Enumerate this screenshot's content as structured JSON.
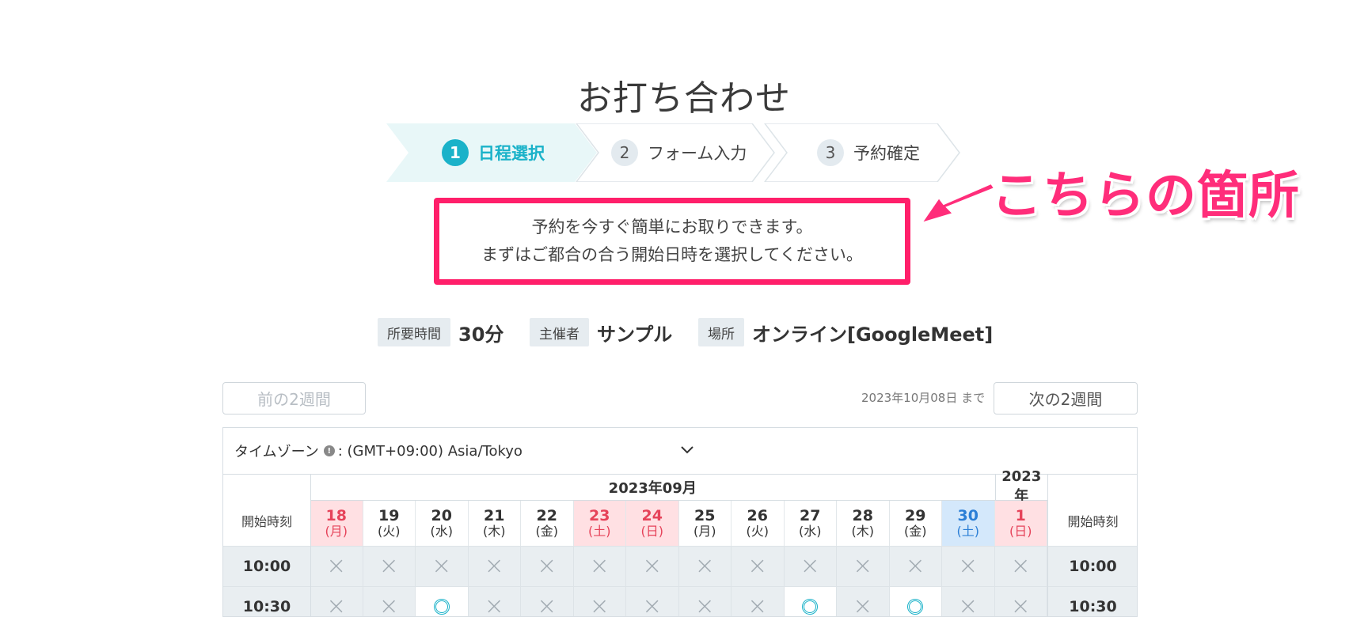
{
  "page": {
    "title": "お打ち合わせ"
  },
  "steps": [
    {
      "num": "1",
      "label": "日程選択",
      "state": "active"
    },
    {
      "num": "2",
      "label": "フォーム入力",
      "state": "inactive"
    },
    {
      "num": "3",
      "label": "予約確定",
      "state": "inactive"
    }
  ],
  "intro": {
    "line1": "予約を今すぐ簡単にお取りできます。",
    "line2": "まずはご都合の合う開始日時を選択してください。"
  },
  "annotation": {
    "text": "こちらの箇所",
    "color": "#ff2d7a"
  },
  "meta": {
    "duration_label": "所要時間",
    "duration_value": "30分",
    "host_label": "主催者",
    "host_value": "サンプル",
    "location_label": "場所",
    "location_value": "オンライン[GoogleMeet]"
  },
  "nav": {
    "prev_label": "前の2週間",
    "next_label": "次の2週間",
    "until_text": "2023年10月08日 まで"
  },
  "calendar": {
    "timezone_label": "タイムゾーン",
    "timezone_value": ": (GMT+09:00) Asia/Tokyo",
    "month1": "2023年09月",
    "month2": "2023年",
    "start_time_label": "開始時刻",
    "days": [
      {
        "date": "18",
        "dow": "(月)",
        "type": "hol"
      },
      {
        "date": "19",
        "dow": "(火)",
        "type": "wk"
      },
      {
        "date": "20",
        "dow": "(水)",
        "type": "wk"
      },
      {
        "date": "21",
        "dow": "(木)",
        "type": "wk"
      },
      {
        "date": "22",
        "dow": "(金)",
        "type": "wk"
      },
      {
        "date": "23",
        "dow": "(土)",
        "type": "hol"
      },
      {
        "date": "24",
        "dow": "(日)",
        "type": "hol"
      },
      {
        "date": "25",
        "dow": "(月)",
        "type": "wk"
      },
      {
        "date": "26",
        "dow": "(火)",
        "type": "wk"
      },
      {
        "date": "27",
        "dow": "(水)",
        "type": "wk"
      },
      {
        "date": "28",
        "dow": "(木)",
        "type": "wk"
      },
      {
        "date": "29",
        "dow": "(金)",
        "type": "wk"
      },
      {
        "date": "30",
        "dow": "(土)",
        "type": "sat"
      },
      {
        "date": "1",
        "dow": "(日)",
        "type": "hol"
      }
    ],
    "rows": [
      {
        "time": "10:00",
        "slots": [
          0,
          0,
          0,
          0,
          0,
          0,
          0,
          0,
          0,
          0,
          0,
          0,
          0,
          0
        ]
      },
      {
        "time": "10:30",
        "slots": [
          0,
          0,
          1,
          0,
          0,
          0,
          0,
          0,
          0,
          1,
          0,
          1,
          0,
          0
        ]
      }
    ]
  },
  "colors": {
    "accent": "#1ab2c9",
    "highlight_border": "#ff1f6a",
    "holiday": "#e6435a",
    "saturday": "#2c7fd6"
  }
}
